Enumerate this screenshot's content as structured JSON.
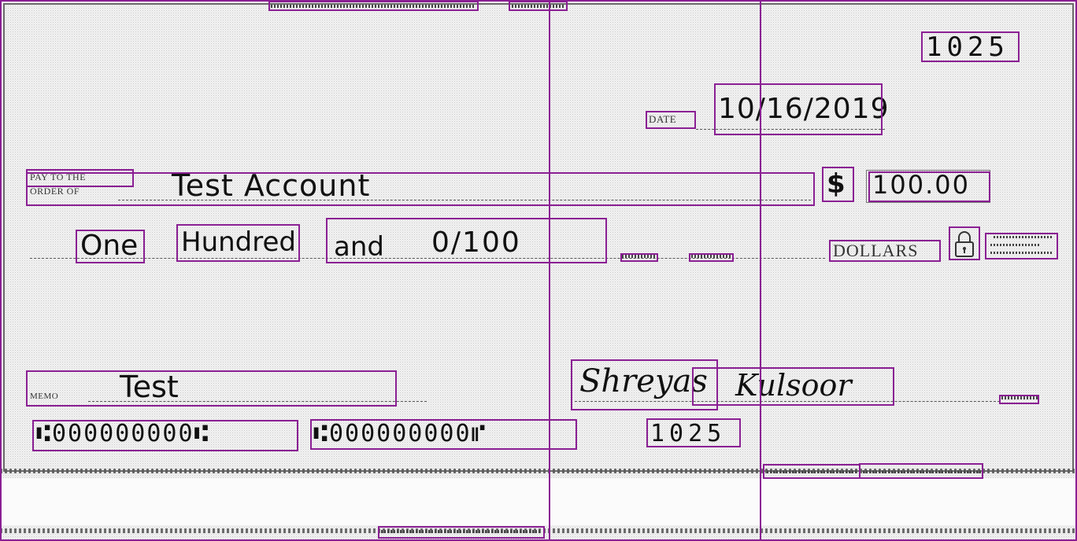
{
  "check": {
    "number": "1025",
    "date_label": "DATE",
    "date_value": "10/16/2019",
    "payee_label_line1": "PAY TO THE",
    "payee_label_line2": "ORDER OF",
    "payee_value": "Test Account",
    "currency_symbol": "$",
    "amount_numeric": "100.00",
    "amount_words": [
      "One",
      "Hundred",
      "and",
      "0/100"
    ],
    "dollars_label": "DOLLARS",
    "memo_label": "MEMO",
    "memo_value": "Test",
    "signature": [
      "Shreyas",
      "Kulsoor"
    ],
    "micr_routing": "⑆000000000⑆",
    "micr_account": "⑆000000000⑈",
    "micr_check_number": "1025",
    "lock_icon": "padlock-icon"
  },
  "colors": {
    "annotation": "#8a1f93",
    "ink": "#111111",
    "paper": "#f4f4f4"
  }
}
